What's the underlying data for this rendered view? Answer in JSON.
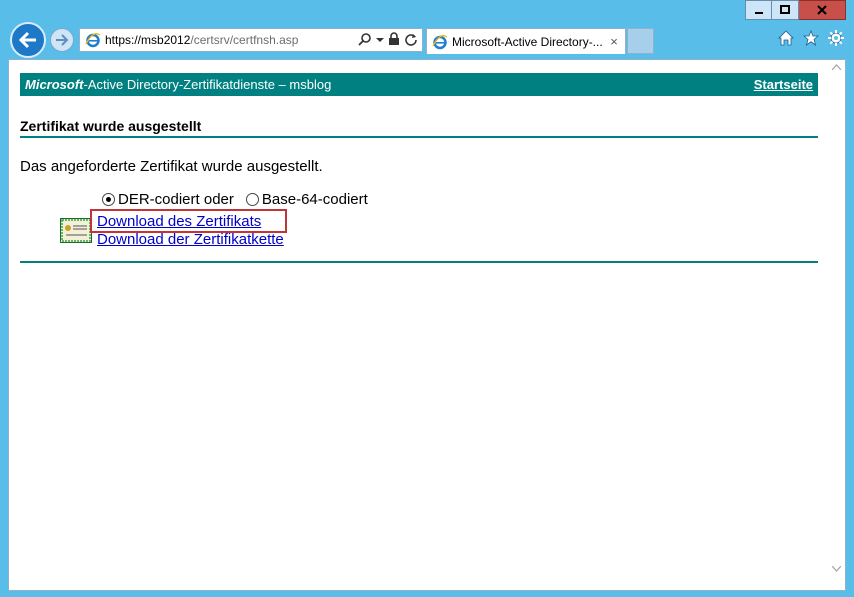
{
  "browser": {
    "url_host": "https://msb2012",
    "url_path": "/certsrv/certfnsh.asp",
    "tab_title": "Microsoft-Active Directory-...",
    "tab_close": "×"
  },
  "header": {
    "brand": "Microsoft",
    "service": "-Active Directory-Zertifikatdienste  –  msblog",
    "home_link": "Startseite"
  },
  "page": {
    "title": "Zertifikat wurde ausgestellt",
    "message": "Das angeforderte Zertifikat wurde ausgestellt.",
    "encoding_options": [
      {
        "label": "DER-codiert  oder",
        "selected": true
      },
      {
        "label": "Base-64-codiert",
        "selected": false
      }
    ],
    "links": {
      "download_cert": "Download des Zertifikats",
      "download_chain": "Download der Zertifikatkette"
    }
  },
  "colors": {
    "accent": "#008080",
    "link": "#0000cc",
    "highlight": "#c0353a"
  }
}
